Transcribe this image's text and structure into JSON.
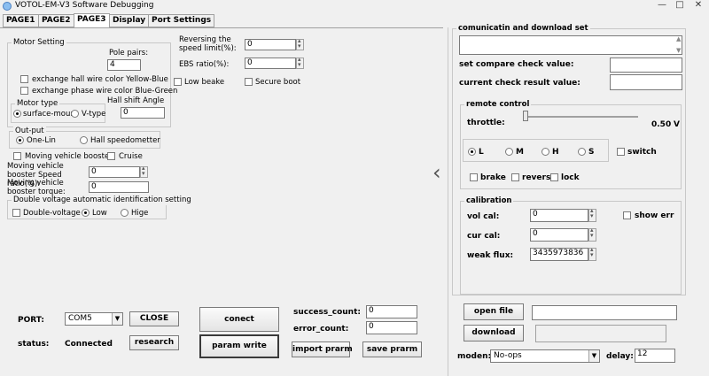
{
  "window": {
    "title": "VOTOL-EM-V3 Software Debugging",
    "minimize": "—",
    "maximize": "□",
    "close": "✕"
  },
  "tabs": [
    "PAGE1",
    "PAGE2",
    "PAGE3",
    "Display",
    "Port Settings"
  ],
  "motor_setting": {
    "title": "Motor Setting",
    "pole_pairs_label": "Pole pairs:",
    "pole_pairs_value": "4",
    "exchange_hall": "exchange hall wire color Yellow-Blue",
    "exchange_phase": "exchange phase wire color Blue-Green",
    "hall_shift_label": "Hall shift Angle",
    "hall_shift_value": "0",
    "motor_type_title": "Motor type",
    "surface_mount": "surface-mount",
    "v_type": "V-type"
  },
  "reversing": {
    "speed_limit_label": "Reversing the speed limit(%):",
    "speed_limit_value": "0",
    "ebs_label": "EBS ratio(%):",
    "ebs_value": "0",
    "low_brake": "Low beake",
    "secure_boot": "Secure boot"
  },
  "output": {
    "title": "Out-put",
    "one_lin": "One-Lin",
    "hall_speed": "Hall speedometter",
    "moving_booster": "Moving vehicle booster",
    "cruise": "Cruise",
    "booster_speed_label": "Moving vehicle booster Speed ratio(%):",
    "booster_speed_value": "0",
    "booster_torque_label": "Moving vehicle booster torque:",
    "booster_torque_value": "0"
  },
  "double_voltage": {
    "title": "Double voltage automatic identification setting",
    "double": "Double-voltage",
    "low": "Low",
    "high": "Hige"
  },
  "port": {
    "port_label": "PORT:",
    "port_value": "COM5",
    "close_btn": "CLOSE",
    "status_label": "status:",
    "status_value": "Connected",
    "research_btn": "research",
    "connect_btn": "conect",
    "param_write_btn": "param write",
    "success_label": "success_count:",
    "success_value": "0",
    "error_label": "error_count:",
    "error_value": "0",
    "import_btn": "import prarm",
    "save_btn": "save prarm"
  },
  "collapse_arrow": "‹",
  "comm": {
    "title": "comunicatin and download set",
    "compare_label": "set compare check value:",
    "compare_value": "",
    "current_label": "current check result value:",
    "current_value": ""
  },
  "remote": {
    "title": "remote control",
    "throttle_label": "throttle:",
    "throttle_value": "0.50",
    "throttle_unit": "V",
    "gear_l": "L",
    "gear_m": "M",
    "gear_h": "H",
    "gear_s": "S",
    "switch_label": "switch",
    "brake": "brake",
    "reverse": "revers",
    "lock": "lock"
  },
  "calibration": {
    "title": "calibration",
    "vol_label": "vol cal:",
    "vol_value": "0",
    "show_err": "show err",
    "cur_label": "cur cal:",
    "cur_value": "0",
    "weak_label": "weak flux:",
    "weak_value": "3435973836"
  },
  "download": {
    "open_file_btn": "open file",
    "file_path": "",
    "download_btn": "download",
    "moden_label": "moden:",
    "moden_value": "No-ops",
    "delay_label": "delay:",
    "delay_value": "12"
  }
}
